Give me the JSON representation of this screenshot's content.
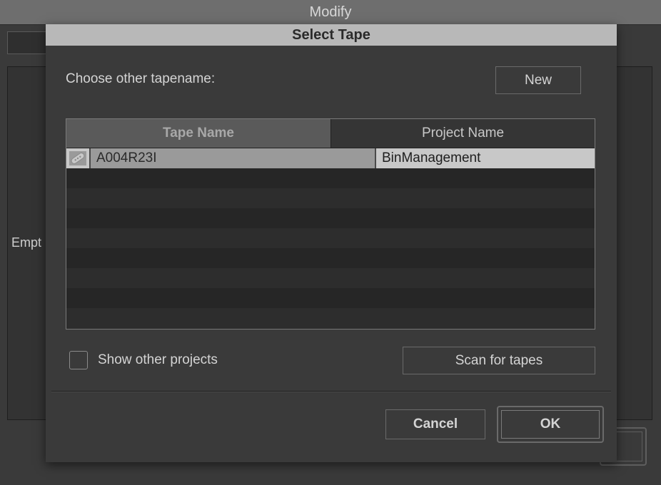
{
  "background": {
    "window_title": "Modify",
    "left_panel_text": "Empt"
  },
  "dialog": {
    "title": "Select Tape",
    "prompt": "Choose other tapename:",
    "new_button": "New",
    "table": {
      "columns": [
        "Tape Name",
        "Project Name"
      ],
      "sorted_column": "Tape Name",
      "rows": [
        {
          "tape_name": "A004R23I",
          "project_name": "BinManagement",
          "selected": true,
          "icon": "tape-icon"
        }
      ]
    },
    "show_other_projects": {
      "label": "Show other projects",
      "checked": false
    },
    "scan_button": "Scan for tapes",
    "cancel_button": "Cancel",
    "ok_button": "OK"
  },
  "colors": {
    "title_bar": "#b8b8b8",
    "selected_row": "#c8c8c8",
    "dialog_bg": "#3a3a3a"
  }
}
